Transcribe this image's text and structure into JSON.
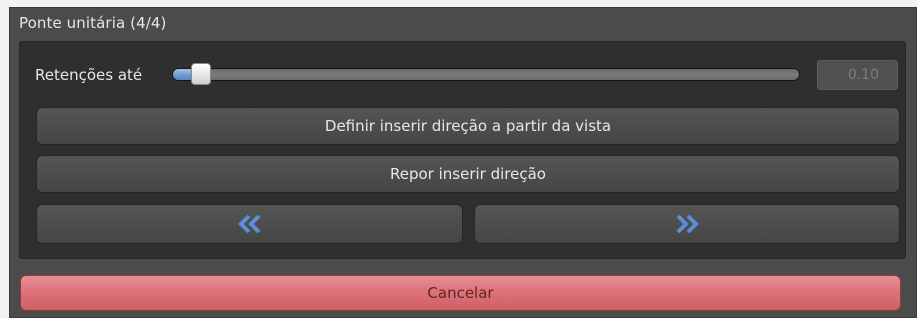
{
  "panel": {
    "title": "Ponte unitária (4/4)"
  },
  "retention": {
    "label": "Retenções até",
    "value": "0.10",
    "slider_fraction": 0.03
  },
  "buttons": {
    "define_direction": "Definir inserir direção a partir da vista",
    "reset_direction": "Repor inserir direção",
    "previous_icon": "double-chevron-left-icon",
    "next_icon": "double-chevron-right-icon",
    "cancel": "Cancelar"
  },
  "colors": {
    "accent_blue": "#5a8fd6",
    "cancel_red": "#dd7379"
  }
}
